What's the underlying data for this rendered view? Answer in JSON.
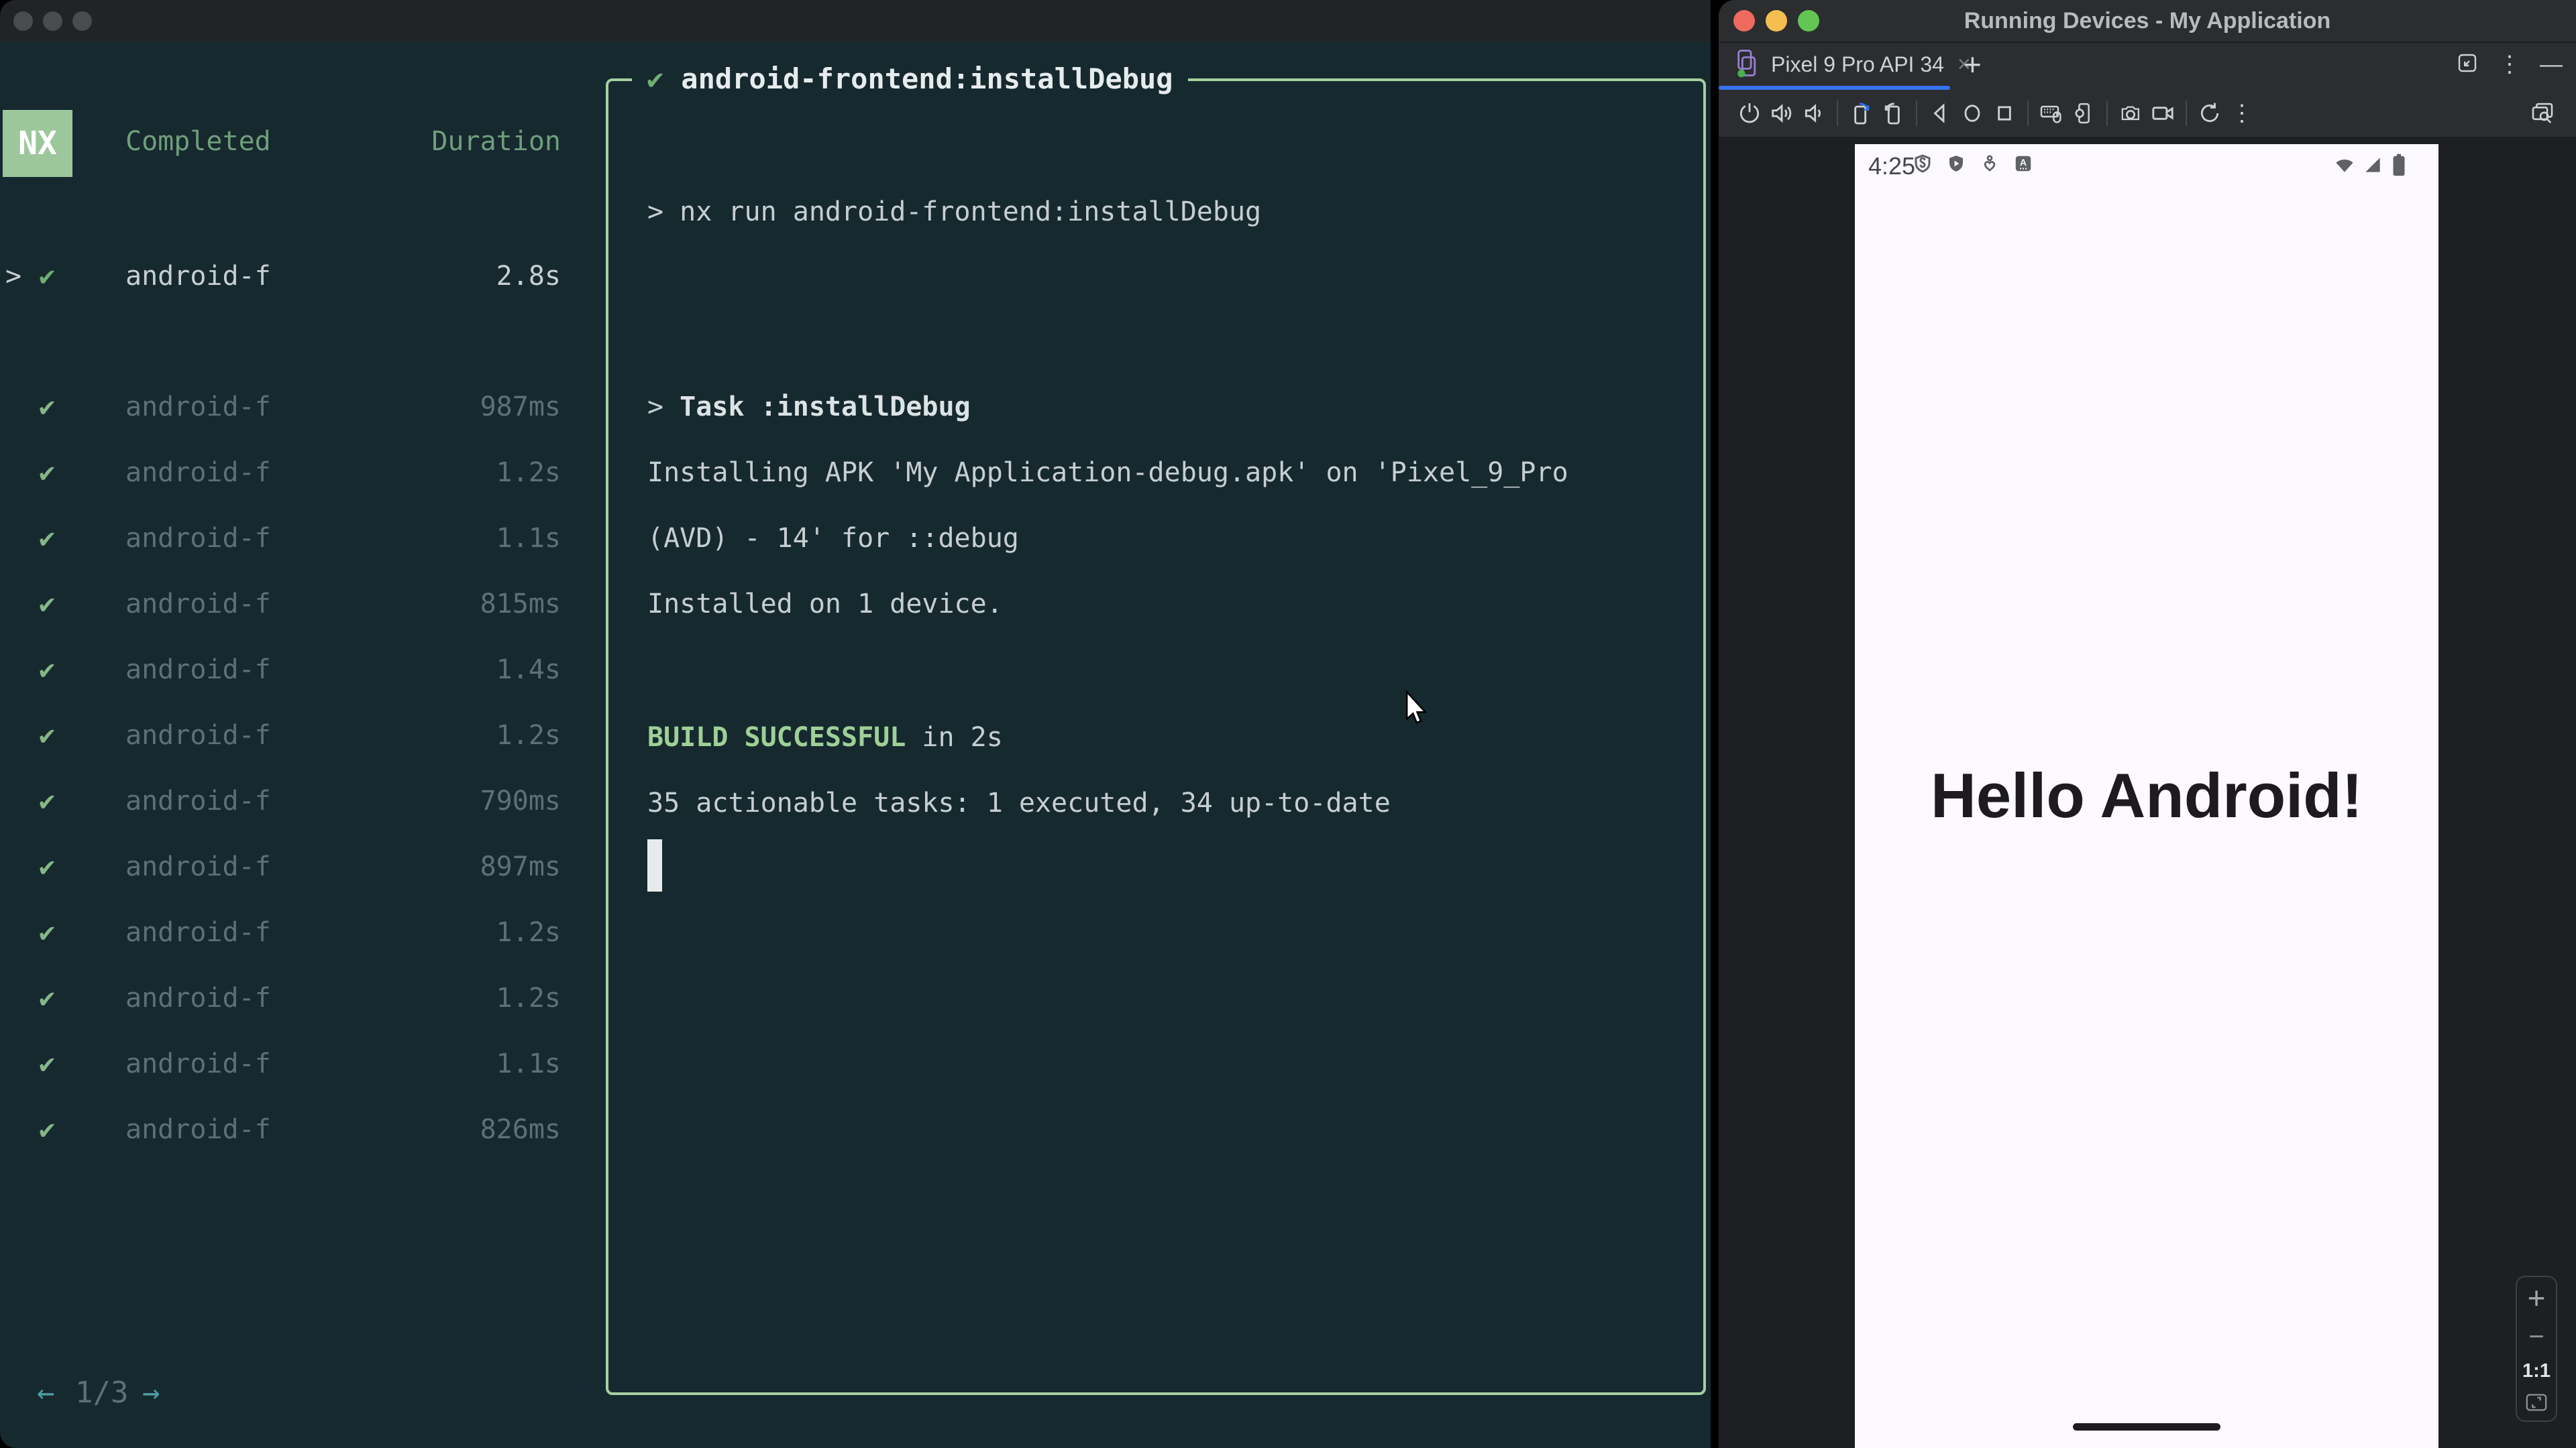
{
  "colors": {
    "terminal_bg": "#16292f",
    "accent_green": "#a6cfa0",
    "check_green": "#85b787",
    "success_green": "#9ed097",
    "dim_text": "#5b7077",
    "bright_text": "#c6ced1",
    "teal_arrow": "#4f9ba3",
    "badge_bg": "#9cc79b",
    "tab_accent_blue": "#3573f0",
    "mac_red": "#ee6a5f",
    "mac_yellow": "#f5bf4f",
    "mac_green": "#62c554"
  },
  "left_window": {
    "task_panel": {
      "badge": "NX",
      "columns": {
        "completed": "Completed",
        "duration": "Duration"
      },
      "selected_task": {
        "chevron": ">",
        "check": "✔",
        "name": "android-f",
        "duration": "2.8s"
      },
      "tasks": [
        {
          "check": "✔",
          "name": "android-f",
          "duration": "987ms"
        },
        {
          "check": "✔",
          "name": "android-f",
          "duration": "1.2s"
        },
        {
          "check": "✔",
          "name": "android-f",
          "duration": "1.1s"
        },
        {
          "check": "✔",
          "name": "android-f",
          "duration": "815ms"
        },
        {
          "check": "✔",
          "name": "android-f",
          "duration": "1.4s"
        },
        {
          "check": "✔",
          "name": "android-f",
          "duration": "1.2s"
        },
        {
          "check": "✔",
          "name": "android-f",
          "duration": "790ms"
        },
        {
          "check": "✔",
          "name": "android-f",
          "duration": "897ms"
        },
        {
          "check": "✔",
          "name": "android-f",
          "duration": "1.2s"
        },
        {
          "check": "✔",
          "name": "android-f",
          "duration": "1.2s"
        },
        {
          "check": "✔",
          "name": "android-f",
          "duration": "1.1s"
        },
        {
          "check": "✔",
          "name": "android-f",
          "duration": "826ms"
        }
      ],
      "pagination": {
        "prev": "←",
        "page": "1/3",
        "next": "→"
      }
    },
    "output_panel": {
      "check": "✔",
      "title": "android-frontend:installDebug",
      "command_line": "> nx run android-frontend:installDebug",
      "task_prefix": "> ",
      "task_header": "Task :installDebug",
      "install_line1": "Installing APK 'My Application-debug.apk' on 'Pixel_9_Pro",
      "install_line2": "(AVD) - 14' for ::debug",
      "installed_line": "Installed on 1 device.",
      "build_status": "BUILD SUCCESSFUL",
      "build_suffix": " in 2s",
      "summary_line": "35 actionable tasks: 1 executed, 34 up-to-date"
    }
  },
  "right_window": {
    "title": "Running Devices - My Application",
    "tab_bar": {
      "tab_label": "Pixel 9 Pro API 34",
      "close": "×",
      "new_tab": "+",
      "more": "⋮",
      "minimize": "—"
    },
    "toolbar_icons": [
      "power-icon",
      "volume-up-icon",
      "volume-down-icon",
      "rotate-left-icon",
      "rotate-right-icon",
      "back-icon",
      "home-icon",
      "overview-icon",
      "hardware-input-icon",
      "device-settings-icon",
      "screenshot-icon",
      "screen-record-icon",
      "restart-icon",
      "more-icon",
      "zoom-preview-icon"
    ],
    "emulator": {
      "status_time": "4:25",
      "hello_text": "Hello Android!",
      "zoom_controls": {
        "zoom_in": "+",
        "zoom_out": "−",
        "actual_size": "1:1"
      }
    }
  }
}
